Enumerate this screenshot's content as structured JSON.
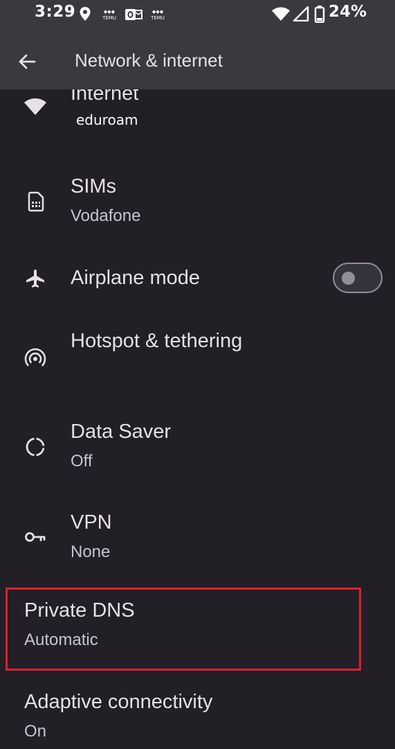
{
  "status_bar": {
    "time": "3:29",
    "battery_percent": "24%",
    "icons": [
      "location-icon",
      "temu-icon",
      "outlook-icon",
      "temu-icon",
      "wifi-icon",
      "cell-signal-icon",
      "battery-icon"
    ],
    "notif_temu_label": "TEMU"
  },
  "app_bar": {
    "back_icon": "arrow-back-icon",
    "title": "Network & internet"
  },
  "items": [
    {
      "title": "Internet",
      "summary": "eduroam",
      "icon": "wifi-icon"
    },
    {
      "title": "SIMs",
      "summary": "Vodafone",
      "icon": "sim-card-icon"
    },
    {
      "title": "Airplane mode",
      "summary": "",
      "icon": "airplane-icon",
      "toggle": false
    },
    {
      "title": "Hotspot & tethering",
      "summary": "",
      "icon": "hotspot-icon"
    },
    {
      "title": "Data Saver",
      "summary": "Off",
      "icon": "data-saver-icon"
    },
    {
      "title": "VPN",
      "summary": "None",
      "icon": "vpn-key-icon"
    },
    {
      "title": "Private DNS",
      "summary": "Automatic",
      "icon": ""
    },
    {
      "title": "Adaptive connectivity",
      "summary": "On",
      "icon": ""
    }
  ],
  "colors": {
    "background": "#221f27",
    "app_bar": "#3b383e",
    "highlight": "#e0202a"
  }
}
